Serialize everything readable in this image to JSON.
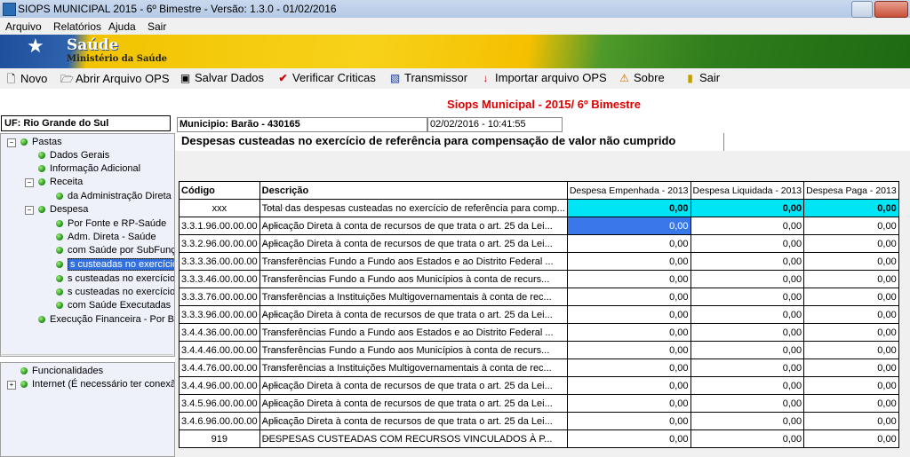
{
  "window": {
    "title": "SIOPS MUNICIPAL 2015 - 6º Bimestre - Versão: 1.3.0 - 01/02/2016"
  },
  "menu": [
    "Arquivo",
    "Relatórios",
    "Ajuda",
    "Sair"
  ],
  "banner": {
    "title": "Saúde",
    "subtitle": "Ministério da Saúde"
  },
  "toolbar": [
    {
      "label": "Novo",
      "icon": "new-document-icon"
    },
    {
      "label": "Abrir Arquivo OPS",
      "icon": "open-folder-icon"
    },
    {
      "label": "Salvar Dados",
      "icon": "floppy-disk-icon"
    },
    {
      "label": "Verificar Criticas",
      "icon": "red-checkmark-icon"
    },
    {
      "label": "Transmissor",
      "icon": "transmit-icon"
    },
    {
      "label": "Importar arquivo OPS",
      "icon": "import-arrow-icon"
    },
    {
      "label": "Sobre",
      "icon": "about-icon"
    },
    {
      "label": "Sair",
      "icon": "exit-door-icon"
    }
  ],
  "heading": "Siops Municipal - 2015/ 6º Bimestre",
  "uf": "UF: Rio Grande do Sul",
  "municipio": "Municipio: Barão - 430165",
  "datetime": "02/02/2016 - 10:41:55",
  "tree": {
    "pastas": "Pastas",
    "dados_gerais": "Dados Gerais",
    "info_adicional": "Informação Adicional",
    "receita": "Receita",
    "receita_child": "da Administração Direta",
    "despesa": "Despesa",
    "despesa_children": [
      "Por Fonte e RP-Saúde",
      "Adm. Direta - Saúde",
      "com Saúde por SubFunç",
      "s custeadas no exercício",
      "s custeadas no exercício",
      "s custeadas no exercício",
      "com Saúde Executadas"
    ],
    "execucao": "Execução Financeira - Por Bl",
    "funcionalidades": "Funcionalidades",
    "internet": "Internet (É necessário ter conexã"
  },
  "section_title": "Despesas custeadas no exercício de referência para compensação de valor não cumprido",
  "grid": {
    "columns": [
      "Código",
      "Descrição",
      "Despesa Empenhada - 2013",
      "Despesa Liquidada - 2013",
      "Despesa Paga - 2013"
    ],
    "rows": [
      {
        "code": "xxx",
        "desc": "Total das despesas custeadas no exercício de referência para comp...",
        "v1": "0,00",
        "v2": "0,00",
        "v3": "0,00"
      },
      {
        "code": "3.3.1.96.00.00.00",
        "desc": "Aplicação Direta à conta de recursos de que trata o art. 25 da Lei...",
        "v1": "0,00",
        "v2": "0,00",
        "v3": "0,00"
      },
      {
        "code": "3.3.2.96.00.00.00",
        "desc": "Aplicação Direta à conta de recursos de que trata o art. 25 da Lei...",
        "v1": "0,00",
        "v2": "0,00",
        "v3": "0,00"
      },
      {
        "code": "3.3.3.36.00.00.00",
        "desc": "Transferências Fundo a Fundo aos Estados e ao Distrito Federal ...",
        "v1": "0,00",
        "v2": "0,00",
        "v3": "0,00"
      },
      {
        "code": "3.3.3.46.00.00.00",
        "desc": "Transferências Fundo a Fundo aos Municípios à conta de recurs...",
        "v1": "0,00",
        "v2": "0,00",
        "v3": "0,00"
      },
      {
        "code": "3.3.3.76.00.00.00",
        "desc": "Transferências a Instituições Multigovernamentais à conta de rec...",
        "v1": "0,00",
        "v2": "0,00",
        "v3": "0,00"
      },
      {
        "code": "3.3.3.96.00.00.00",
        "desc": "Aplicação Direta à conta de recursos de que trata o art. 25 da Lei...",
        "v1": "0,00",
        "v2": "0,00",
        "v3": "0,00"
      },
      {
        "code": "3.4.4.36.00.00.00",
        "desc": "Transferências Fundo a Fundo aos Estados e ao Distrito Federal ...",
        "v1": "0,00",
        "v2": "0,00",
        "v3": "0,00"
      },
      {
        "code": "3.4.4.46.00.00.00",
        "desc": "Transferências Fundo a Fundo aos Municípios à conta de recurs...",
        "v1": "0,00",
        "v2": "0,00",
        "v3": "0,00"
      },
      {
        "code": "3.4.4.76.00.00.00",
        "desc": "Transferências a Instituições Multigovernamentais à conta de rec...",
        "v1": "0,00",
        "v2": "0,00",
        "v3": "0,00"
      },
      {
        "code": "3.4.4.96.00.00.00",
        "desc": "Aplicação Direta à conta de recursos de que trata o art. 25 da Lei...",
        "v1": "0,00",
        "v2": "0,00",
        "v3": "0,00"
      },
      {
        "code": "3.4.5.96.00.00.00",
        "desc": "Aplicação Direta à conta de recursos de que trata o art. 25 da Lei...",
        "v1": "0,00",
        "v2": "0,00",
        "v3": "0,00"
      },
      {
        "code": "3.4.6.96.00.00.00",
        "desc": "Aplicação Direta à conta de recursos de que trata o art. 25 da Lei...",
        "v1": "0,00",
        "v2": "0,00",
        "v3": "0,00"
      },
      {
        "code": "919",
        "desc": "DESPESAS CUSTEADAS COM RECURSOS VINCULADOS À P...",
        "v1": "0,00",
        "v2": "0,00",
        "v3": "0,00"
      }
    ]
  }
}
